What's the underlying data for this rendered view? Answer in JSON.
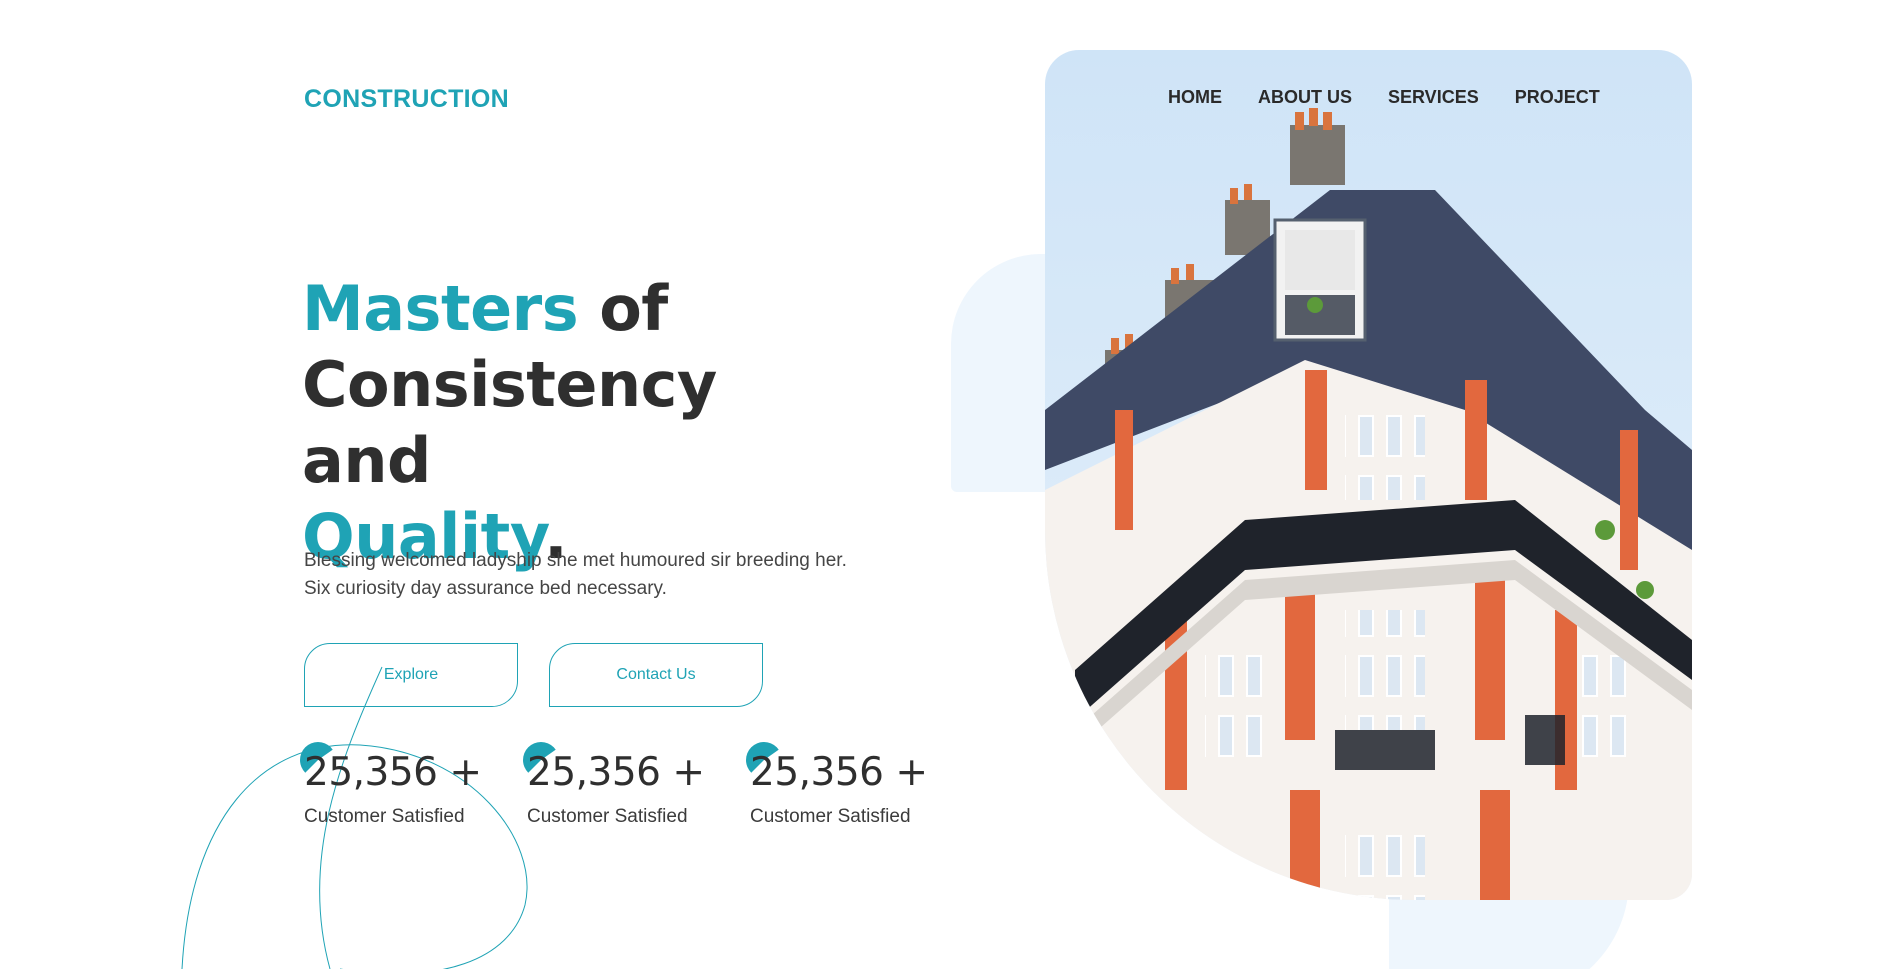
{
  "brand": {
    "logo_text": "CONSTRUCTION"
  },
  "nav": {
    "items": [
      "HOME",
      "ABOUT US",
      "SERVICES",
      "PROJECT"
    ]
  },
  "hero": {
    "headline": {
      "word1": "Masters",
      "word2": " of",
      "word3": "Consistency and",
      "word4": "Quality",
      "word5": "."
    },
    "description": "Blessing welcomed ladyship she met humoured sir breeding her. Six curiosity day assurance bed necessary.",
    "buttons": {
      "explore": "Explore",
      "contact": "Contact Us"
    },
    "image_icon": "building-photo"
  },
  "stats": [
    {
      "value": "25,356 +",
      "label": "Customer Satisfied"
    },
    {
      "value": "25,356 +",
      "label": "Customer Satisfied"
    },
    {
      "value": "25,356 +",
      "label": "Customer Satisfied"
    }
  ],
  "colors": {
    "accent": "#1fa3b5",
    "text": "#2f2f2f",
    "decor_light": "#eef6fd"
  }
}
